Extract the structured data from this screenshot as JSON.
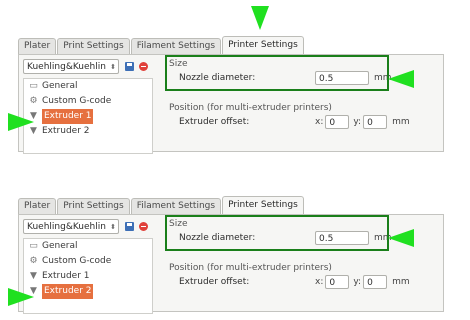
{
  "tabs": [
    "Plater",
    "Print Settings",
    "Filament Settings",
    "Printer Settings"
  ],
  "colors": {
    "highlight": "#1a7f1a",
    "arrow": "#20e020",
    "selection": "#e6703f"
  },
  "panel1": {
    "preset": "Kuehling&Kuehlin",
    "tree": [
      {
        "label": "General",
        "icon": "printer-icon"
      },
      {
        "label": "Custom G-code",
        "icon": "cog-icon"
      },
      {
        "label": "Extruder 1",
        "icon": "funnel-icon",
        "selected": true
      },
      {
        "label": "Extruder 2",
        "icon": "funnel-icon"
      }
    ],
    "size_title": "Size",
    "nozzle_label": "Nozzle diameter:",
    "nozzle_value": "0.5",
    "nozzle_unit": "mm",
    "position_title": "Position (for multi-extruder printers)",
    "offset_label": "Extruder offset:",
    "x_label": "x:",
    "x_value": "0",
    "y_label": "y:",
    "y_value": "0",
    "offset_unit": "mm"
  },
  "panel2": {
    "preset": "Kuehling&Kuehlin",
    "tree": [
      {
        "label": "General",
        "icon": "printer-icon"
      },
      {
        "label": "Custom G-code",
        "icon": "cog-icon"
      },
      {
        "label": "Extruder 1",
        "icon": "funnel-icon"
      },
      {
        "label": "Extruder 2",
        "icon": "funnel-icon",
        "selected": true
      }
    ],
    "size_title": "Size",
    "nozzle_label": "Nozzle diameter:",
    "nozzle_value": "0.5",
    "nozzle_unit": "mm",
    "position_title": "Position (for multi-extruder printers)",
    "offset_label": "Extruder offset:",
    "x_label": "x:",
    "x_value": "0",
    "y_label": "y:",
    "y_value": "0",
    "offset_unit": "mm"
  }
}
